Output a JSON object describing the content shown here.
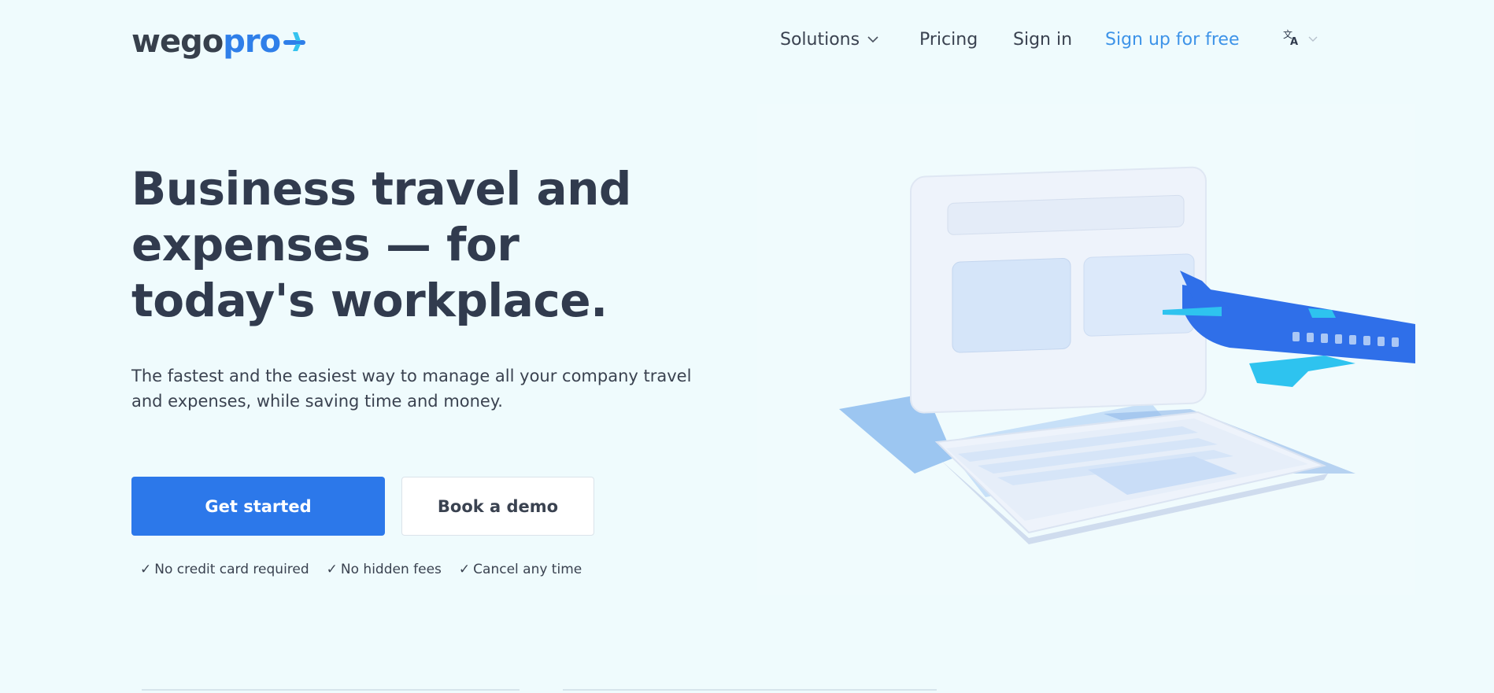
{
  "header": {
    "logo": {
      "part1": "wego",
      "part2": "pro",
      "icon": "plane-icon"
    },
    "nav": {
      "solutions": "Solutions",
      "pricing": "Pricing",
      "signin": "Sign in",
      "signup": "Sign up for free",
      "language_icon": "translate-icon"
    }
  },
  "hero": {
    "title": "Business travel and expenses — for today's workplace.",
    "subtitle": "The fastest and the easiest way to manage all your company travel and expenses, while saving time and money.",
    "primary_button": "Get started",
    "secondary_button": "Book a demo",
    "perks": [
      "No credit card required",
      "No hidden fees",
      "Cancel any time"
    ]
  },
  "illustration": {
    "subject": "laptop-with-airplane",
    "colors": {
      "plane": "#2f6fe9",
      "wing": "#2ec3ef",
      "laptop": "#f2f6fd",
      "shadow": "#8dbcee"
    }
  },
  "colors": {
    "background": "#effbfd",
    "accent": "#2c78ea",
    "link": "#3d93e8",
    "text": "#313b4e"
  }
}
